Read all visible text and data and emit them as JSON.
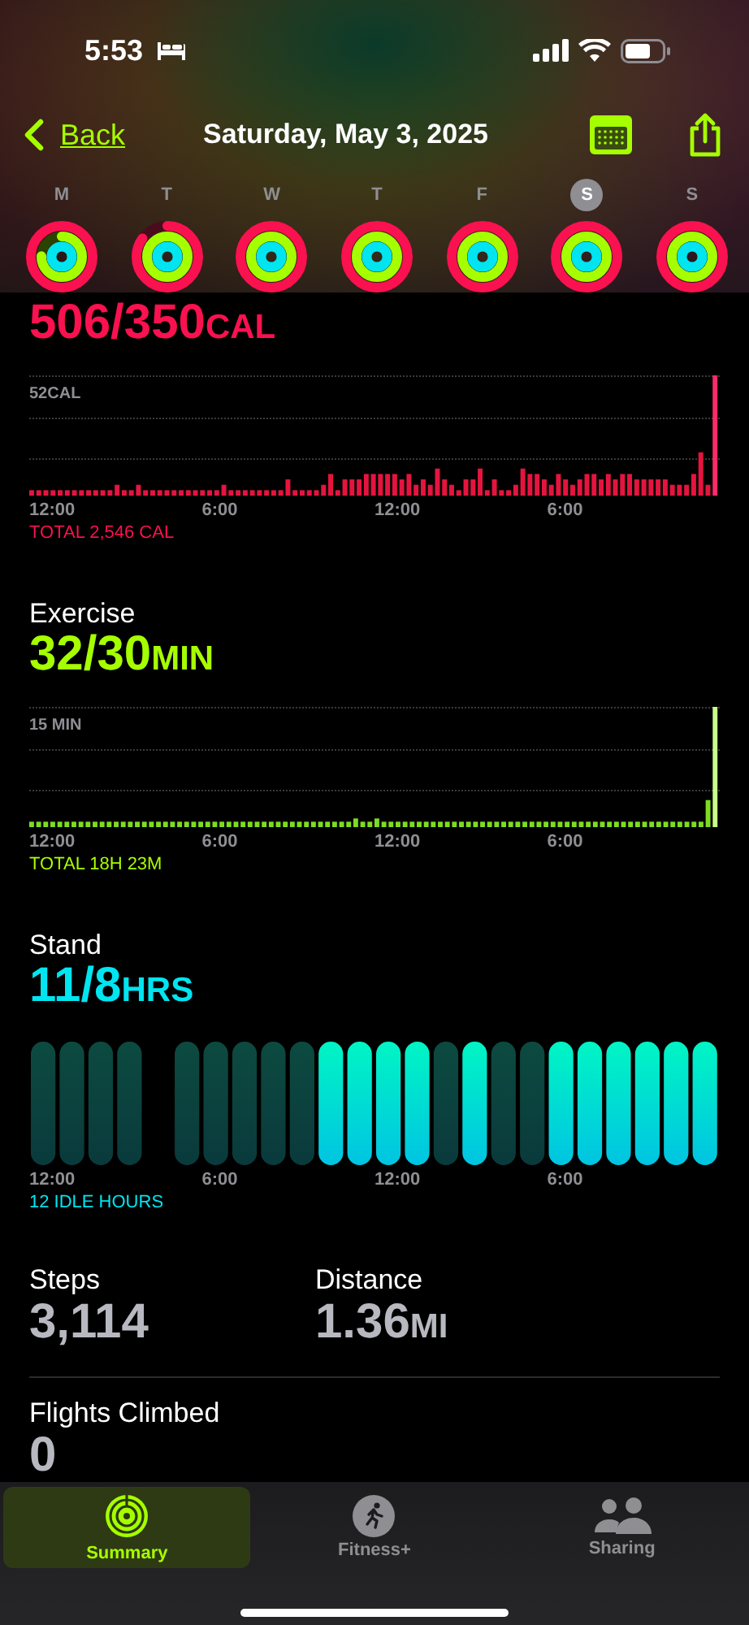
{
  "status_bar": {
    "time": "5:53"
  },
  "nav": {
    "back": "Back",
    "title": "Saturday, May 3, 2025"
  },
  "week": [
    {
      "day": "M",
      "selected": false,
      "rings": [
        {
          "kind": "move",
          "level": 1
        },
        {
          "kind": "exercise",
          "level": 0.75
        },
        {
          "kind": "stand",
          "level": 1
        }
      ]
    },
    {
      "day": "T",
      "selected": false,
      "rings": [
        {
          "kind": "move",
          "level": 0.85
        },
        {
          "kind": "exercise",
          "level": 1
        },
        {
          "kind": "stand",
          "level": 1
        }
      ]
    },
    {
      "day": "W",
      "selected": false,
      "rings": [
        {
          "kind": "move",
          "level": 1
        },
        {
          "kind": "exercise",
          "level": 1
        },
        {
          "kind": "stand",
          "level": 1
        }
      ]
    },
    {
      "day": "T",
      "selected": false,
      "rings": [
        {
          "kind": "move",
          "level": 1
        },
        {
          "kind": "exercise",
          "level": 1
        },
        {
          "kind": "stand",
          "level": 1
        }
      ]
    },
    {
      "day": "F",
      "selected": false,
      "rings": [
        {
          "kind": "move",
          "level": 1
        },
        {
          "kind": "exercise",
          "level": 1
        },
        {
          "kind": "stand",
          "level": 1
        }
      ]
    },
    {
      "day": "S",
      "selected": true,
      "rings": [
        {
          "kind": "move",
          "level": 1
        },
        {
          "kind": "exercise",
          "level": 1
        },
        {
          "kind": "stand",
          "level": 1
        }
      ]
    },
    {
      "day": "S",
      "selected": false,
      "rings": [
        {
          "kind": "move",
          "level": 1
        },
        {
          "kind": "exercise",
          "level": 1
        },
        {
          "kind": "stand",
          "level": 1
        }
      ]
    }
  ],
  "move": {
    "value": "506/350",
    "unit": "CAL",
    "axis_max": "52CAL",
    "times": [
      "12:00",
      "6:00",
      "12:00",
      "6:00"
    ],
    "total": "TOTAL 2,546 CAL"
  },
  "exercise": {
    "title": "Exercise",
    "value": "32/30",
    "unit": "MIN",
    "axis_max": "15 MIN",
    "times": [
      "12:00",
      "6:00",
      "12:00",
      "6:00"
    ],
    "total": "TOTAL 18H 23M"
  },
  "stand": {
    "title": "Stand",
    "value": "11/8",
    "unit": "HRS",
    "times": [
      "12:00",
      "6:00",
      "12:00",
      "6:00"
    ],
    "total": "12 IDLE HOURS",
    "hours": [
      {
        "kind": "idle"
      },
      {
        "kind": "idle"
      },
      {
        "kind": "idle"
      },
      {
        "kind": "idle"
      },
      {
        "kind": "none"
      },
      {
        "kind": "idle"
      },
      {
        "kind": "idle"
      },
      {
        "kind": "idle"
      },
      {
        "kind": "idle"
      },
      {
        "kind": "idle"
      },
      {
        "kind": "stood"
      },
      {
        "kind": "stood"
      },
      {
        "kind": "stood"
      },
      {
        "kind": "stood"
      },
      {
        "kind": "idle"
      },
      {
        "kind": "stood"
      },
      {
        "kind": "idle"
      },
      {
        "kind": "idle"
      },
      {
        "kind": "stood"
      },
      {
        "kind": "stood"
      },
      {
        "kind": "stood"
      },
      {
        "kind": "stood"
      },
      {
        "kind": "stood"
      },
      {
        "kind": "stood"
      }
    ]
  },
  "stats": [
    {
      "label": "Steps",
      "value": "3,114"
    },
    {
      "label": "Distance",
      "value": "1.36",
      "unit": "MI"
    }
  ],
  "flights": {
    "label": "Flights Climbed",
    "value": "0"
  },
  "tabs": [
    {
      "kind": "summary",
      "label": "Summary",
      "selected": true
    },
    {
      "kind": "fitness",
      "label": "Fitness+",
      "selected": false
    },
    {
      "kind": "sharing",
      "label": "Sharing",
      "selected": false
    }
  ]
}
